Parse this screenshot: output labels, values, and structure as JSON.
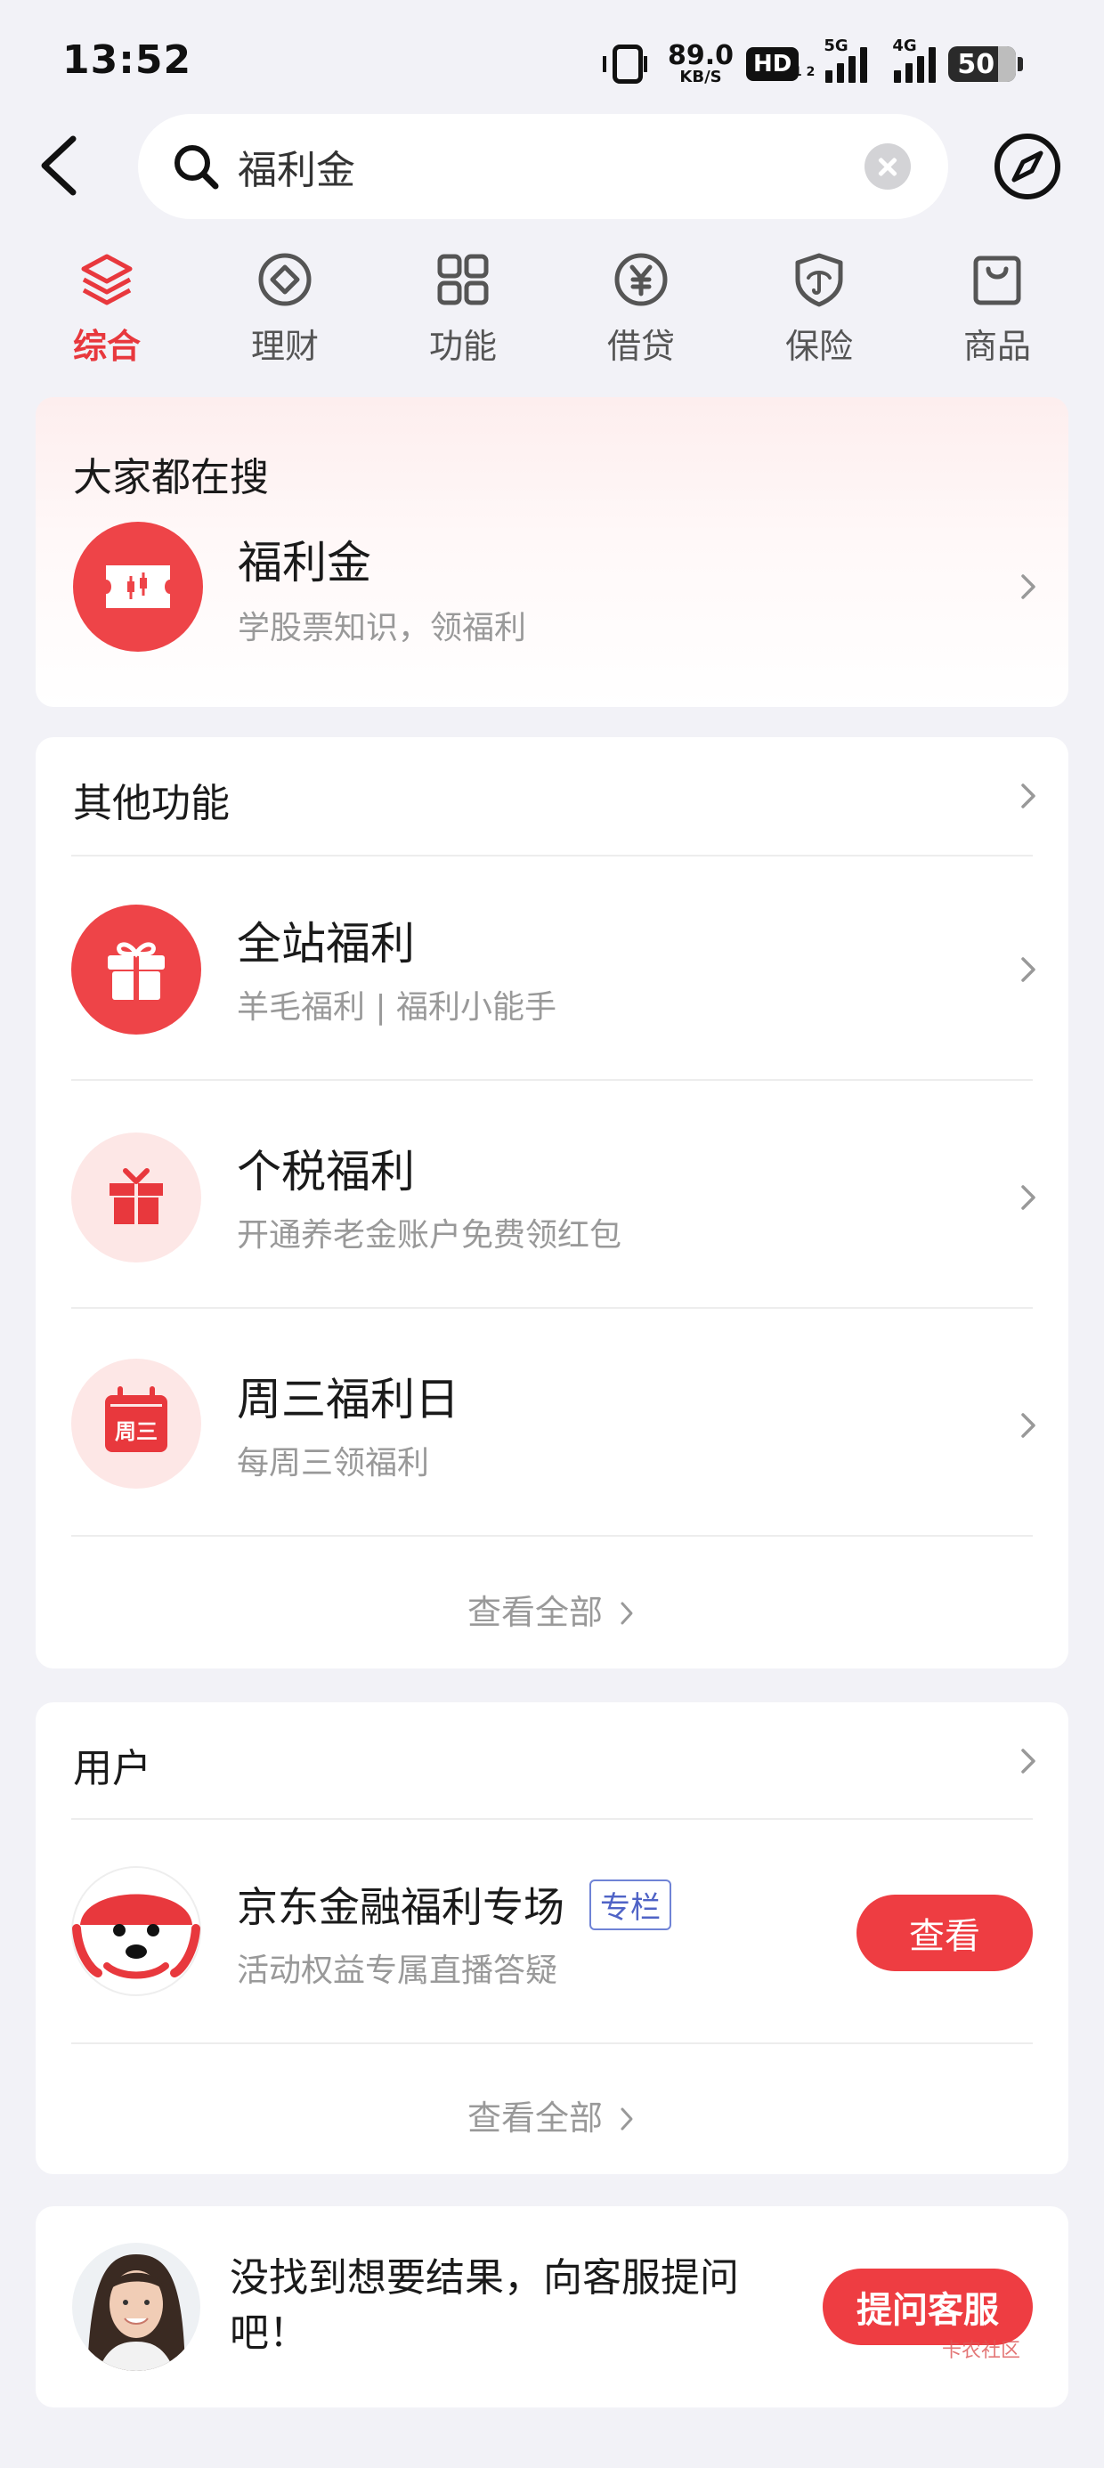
{
  "status_bar": {
    "time": "13:52",
    "net_speed": "89.0",
    "net_unit": "KB/S",
    "hd": "HD",
    "hd_sub": "1 2",
    "sig1": "5G",
    "sig2": "4G",
    "battery": "50",
    "icons": [
      "vibrate-icon",
      "signal-icon",
      "battery-icon"
    ]
  },
  "search": {
    "query": "福利金",
    "icons": [
      "back-icon",
      "search-icon",
      "clear-icon",
      "compass-icon"
    ]
  },
  "tabs": [
    {
      "label": "综合",
      "icon": "layers-icon",
      "active": true
    },
    {
      "label": "理财",
      "icon": "diamond-coin-icon"
    },
    {
      "label": "功能",
      "icon": "grid-icon"
    },
    {
      "label": "借贷",
      "icon": "yuan-icon"
    },
    {
      "label": "保险",
      "icon": "shield-icon"
    },
    {
      "label": "商品",
      "icon": "bag-icon"
    }
  ],
  "hot": {
    "title": "大家都在搜",
    "item": {
      "title": "福利金",
      "subtitle": "学股票知识，领福利",
      "icon": "ticket-icon"
    }
  },
  "functions": {
    "title": "其他功能",
    "items": [
      {
        "title": "全站福利",
        "subtitle": "羊毛福利 | 福利小能手",
        "icon": "gift-icon"
      },
      {
        "title": "个税福利",
        "subtitle": "开通养老金账户免费领红包",
        "icon": "gift-box-icon"
      },
      {
        "title": "周三福利日",
        "subtitle": "每周三领福利",
        "icon": "calendar-icon",
        "icon_text": "周三"
      }
    ],
    "see_all": "查看全部"
  },
  "users": {
    "title": "用户",
    "item": {
      "name": "京东金融福利专场",
      "tag": "专栏",
      "desc": "活动权益专属直播答疑",
      "button": "查看",
      "icon": "mascot-avatar-icon"
    },
    "see_all": "查看全部"
  },
  "service": {
    "text_line1": "没找到想要结果，向客服提问",
    "text_line2": "吧！",
    "button": "提问客服",
    "icon": "agent-avatar-icon"
  },
  "watermark": "卡农社区",
  "colors": {
    "brand_red": "#ee3d42",
    "background": "#f2f2f7",
    "tag_blue": "#4f63c6"
  }
}
